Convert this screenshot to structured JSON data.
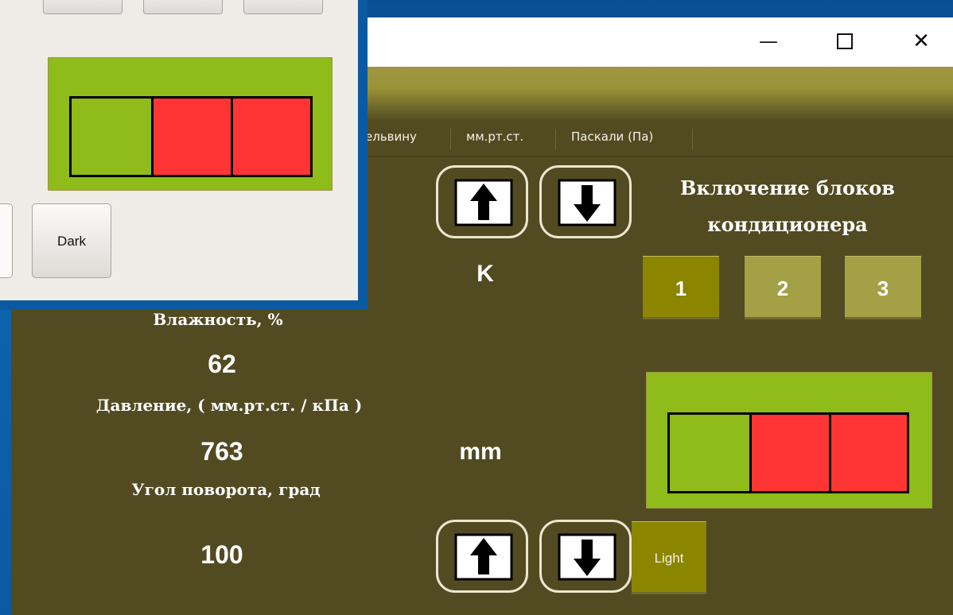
{
  "window_controls": {
    "minimize": "—",
    "maximize": "□",
    "close": "✕"
  },
  "menu": {
    "items": [
      "ельвину",
      "мм.рт.ст.",
      "Паскали (Па)"
    ]
  },
  "units": {
    "temp_unit": "K",
    "pressure_unit": "mm"
  },
  "readings": {
    "humidity_label": "Влажность, %",
    "humidity_value": "62",
    "pressure_label": "Давление, ( мм.рт.ст. / кПа )",
    "pressure_value": "763",
    "angle_label": "Угол поворота, град",
    "angle_value": "100"
  },
  "ac": {
    "title_line1": "Включение блоков",
    "title_line2": "кондиционера",
    "buttons": [
      "1",
      "2",
      "3"
    ]
  },
  "theme": {
    "light_label": "Light",
    "dark_label": "Dark"
  },
  "indicator": {
    "cells": [
      "green",
      "red",
      "red"
    ]
  },
  "colors": {
    "bg_dark": "#524b22",
    "accent_olive": "#8b8500",
    "indicator_frame": "#8fbb1b",
    "cell_green": "#8fbb1b",
    "cell_red": "#ff3535"
  },
  "icons": {
    "arrow_up": "arrow-up-icon",
    "arrow_down": "arrow-down-icon"
  }
}
